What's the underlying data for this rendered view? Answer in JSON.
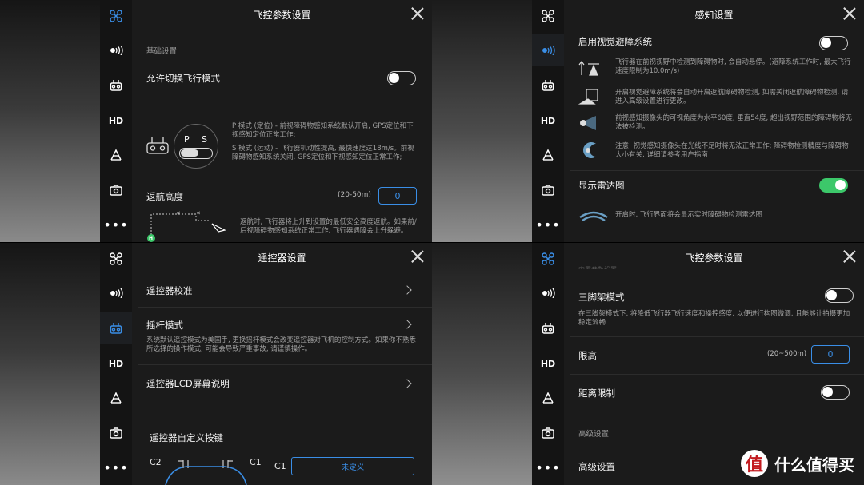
{
  "colors": {
    "accent_blue": "#3a8ee6",
    "toggle_on": "#3cc86a",
    "panel_bg": "#1b1b1b",
    "sidebar_bg": "#141414"
  },
  "sidebar_icons": [
    "drone-icon",
    "signal-icon",
    "controller-icon",
    "hd-label",
    "gimbal-icon",
    "camera-icon",
    "more-icon"
  ],
  "sidebar": {
    "hd": "HD",
    "more": "•••"
  },
  "q1": {
    "title": "飞控参数设置",
    "section_basic": "基础设置",
    "allow_mode_switch": "允许切换飞行模式",
    "mode_switch_on": false,
    "switch_p": "P",
    "switch_s": "S",
    "p_mode_desc": "P 模式 (定位) - 前视障碍物感知系统默认开启, GPS定位和下视感知定位正常工作;",
    "s_mode_desc": "S 模式 (运动) - 飞行器机动性提高, 最快速度达18m/s。前视障碍物感知系统关闭, GPS定位和下视感知定位正常工作;",
    "rth_label": "返航高度",
    "rth_range": "(20-50m)",
    "rth_value": "0",
    "rth_desc": "返航时, 飞行器将上升到设置的最低安全高度返航。如果前/后视障碍物感知系统正常工作, 飞行器遇障会上升躲避。",
    "home_badge": "H",
    "arrow_marks": "«",
    "active_tab": "drone"
  },
  "q2": {
    "title": "感知设置",
    "vision_avoid_label": "启用视觉避障系统",
    "vision_avoid_on": false,
    "info": [
      {
        "icon": "hover-icon",
        "text": "飞行器在前视视野中检测到障碍物时, 会自动悬停。(避障系统工作时, 最大飞行速度限制为10.0m/s)"
      },
      {
        "icon": "return-avoid-icon",
        "text": "开启视觉避障系统将会自动开启返航障碍物检测, 如需关闭返航障碍物检测, 请进入高级设置进行更改。"
      },
      {
        "icon": "sensor-angle-icon",
        "text": "前视感知摄像头的可视角度为水平60度, 垂直54度, 超出视野范围的障碍物将无法被检测。"
      },
      {
        "icon": "warning-night-icon",
        "text": "注意: 视觉感知摄像头在光线不足时将无法正常工作; 障碍物检测精度与障碍物大小有关, 详细请参考用户指南"
      }
    ],
    "radar_label": "显示雷达图",
    "radar_on": true,
    "radar_desc": "开启时, 飞行界面将会显示实时障碍物检测雷达图",
    "active_tab": "signal"
  },
  "q3": {
    "title": "遥控器设置",
    "calibration": "遥控器校准",
    "stick_mode": "摇杆模式",
    "stick_desc": "系统默认遥控模式为美国手, 更换摇杆模式会改变遥控器对飞机的控制方式。如果你不熟悉所选择的操作模式, 可能会导致严重事故, 请谨慎操作。",
    "lcd_help": "遥控器LCD屏幕说明",
    "custom_keys": "遥控器自定义按键",
    "c2": "C2",
    "c1": "C1",
    "c1_row_label": "C1",
    "c1_value": "未定义",
    "active_tab": "controller"
  },
  "q4": {
    "title": "飞控参数设置",
    "cut_text": "内置参数设置",
    "tripod_label": "三脚架模式",
    "tripod_on": false,
    "tripod_desc": "在三脚架模式下, 将降低飞行器飞行速度和操控感度, 以便进行构图微调, 且能够让拍摄更加稳定流畅",
    "height_limit_label": "限高",
    "height_limit_range": "(20~500m)",
    "height_limit_value": "0",
    "distance_limit_label": "距离限制",
    "distance_limit_on": false,
    "advanced_section": "高级设置",
    "advanced_item": "高级设置",
    "active_tab": "drone"
  },
  "watermark": {
    "logo": "值",
    "text": "什么值得买"
  }
}
